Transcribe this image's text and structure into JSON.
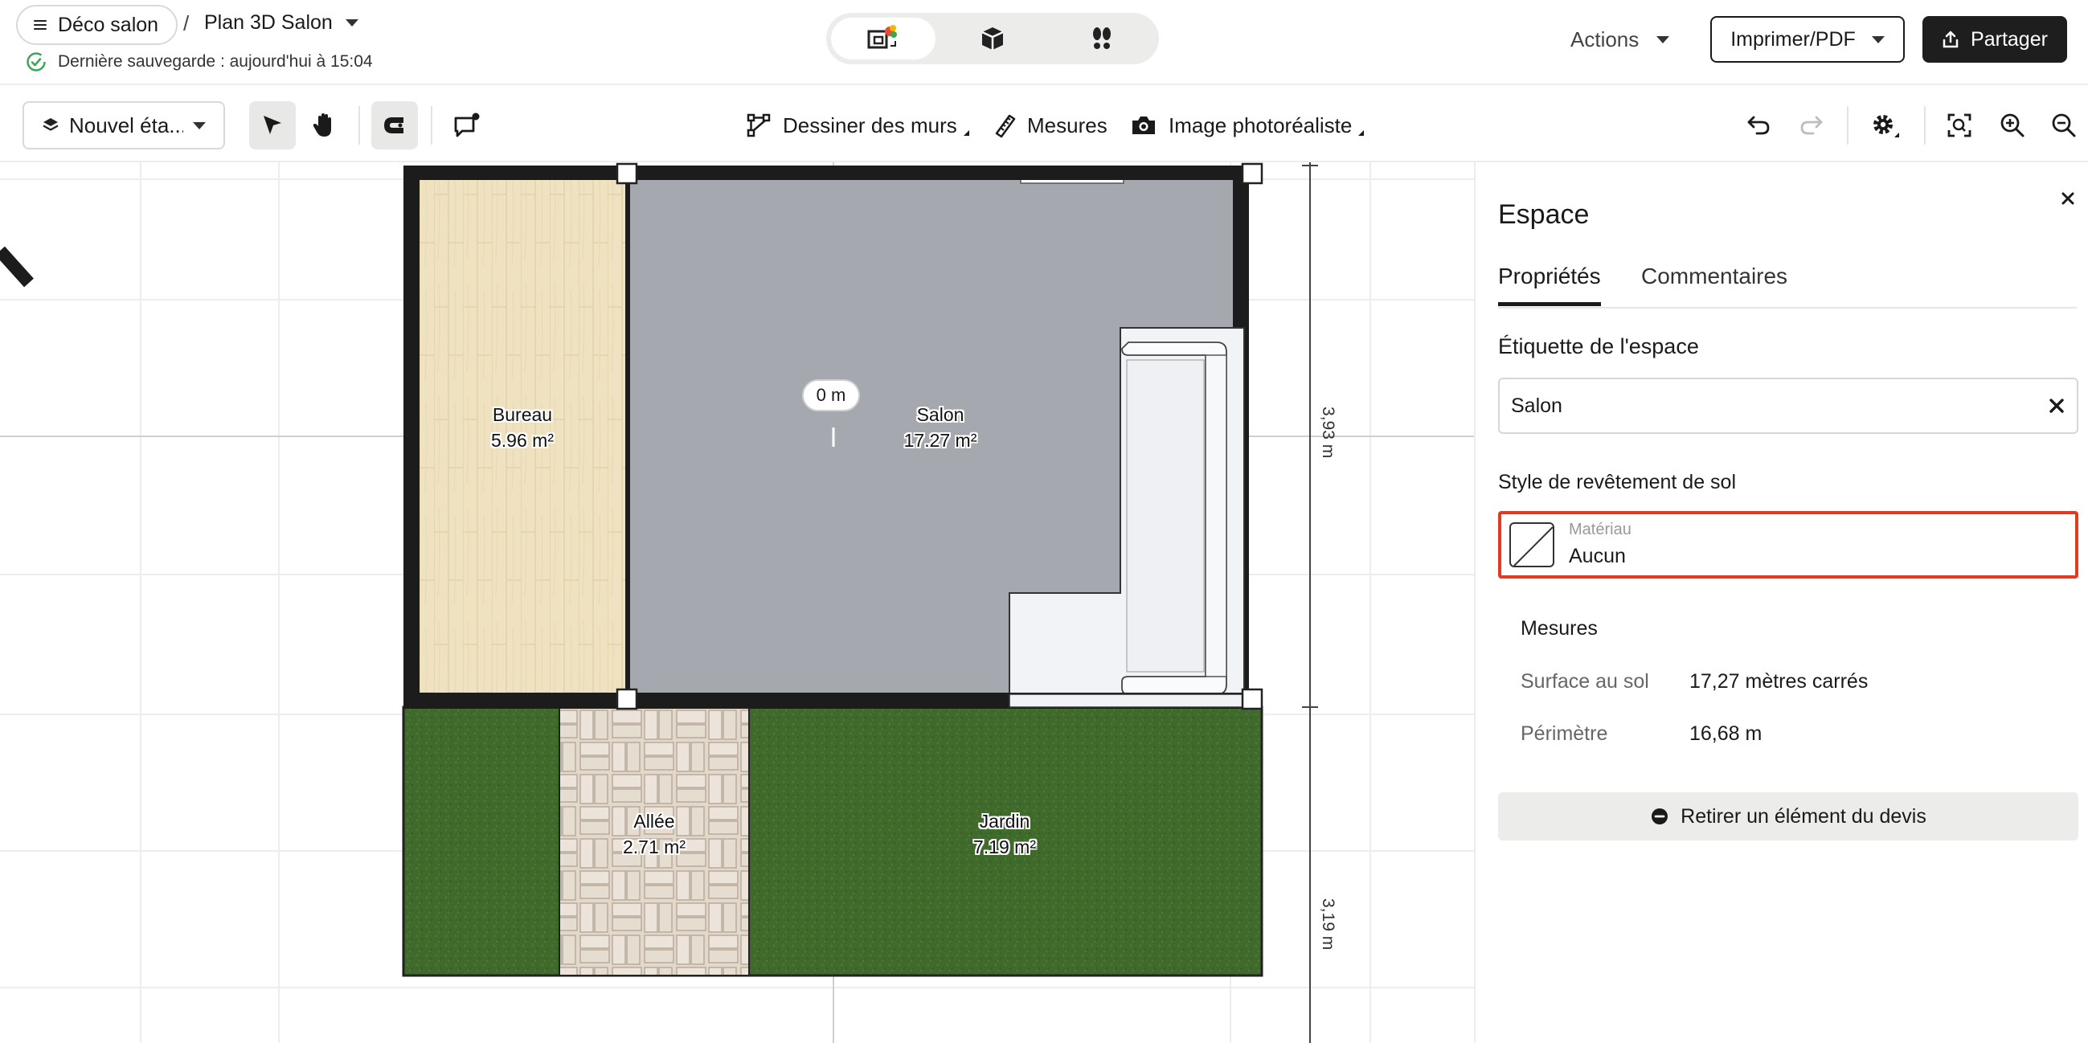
{
  "header": {
    "project_name": "Déco salon",
    "breadcrumb_separator": "/",
    "plan_name": "Plan 3D Salon",
    "save_status": "Dernière sauvegarde : aujourd'hui à 15:04",
    "view_modes": [
      "plan-2d-icon",
      "view-3d-icon",
      "walkthrough-icon"
    ],
    "actions_label": "Actions",
    "print_label": "Imprimer/PDF",
    "share_label": "Partager"
  },
  "toolbar": {
    "level_label": "Nouvel éta...",
    "draw_walls_label": "Dessiner des murs",
    "measures_label": "Mesures",
    "photo_label": "Image photoréaliste"
  },
  "canvas": {
    "rooms": [
      {
        "name": "Bureau",
        "area": "5.96 m²"
      },
      {
        "name": "Salon",
        "area": "17.27 m²"
      },
      {
        "name": "Allée",
        "area": "2.71 m²"
      },
      {
        "name": "Jardin",
        "area": "7.19 m²"
      }
    ],
    "measure_bubble": "0 m",
    "dimension_top": "3,93 m",
    "dimension_bottom": "3,19 m",
    "colors": {
      "wall": "#1c1c1c",
      "salon_floor": "#a6a8b0",
      "bureau_floor": "#efe2c0",
      "garden": "#3f6a2c",
      "path": "#e2d8cc"
    }
  },
  "panel": {
    "title": "Espace",
    "tabs": [
      {
        "label": "Propriétés",
        "active": true
      },
      {
        "label": "Commentaires",
        "active": false
      }
    ],
    "label_section": "Étiquette de l'espace",
    "label_value": "Salon",
    "floor_section": "Style de revêtement de sol",
    "material_caption": "Matériau",
    "material_value": "Aucun",
    "measures_title": "Mesures",
    "measures": [
      {
        "key": "Surface au sol",
        "value": "17,27 mètres carrés"
      },
      {
        "key": "Périmètre",
        "value": "16,68 m"
      }
    ],
    "remove_label": "Retirer un élément du devis",
    "highlight_color": "#e23b22"
  }
}
